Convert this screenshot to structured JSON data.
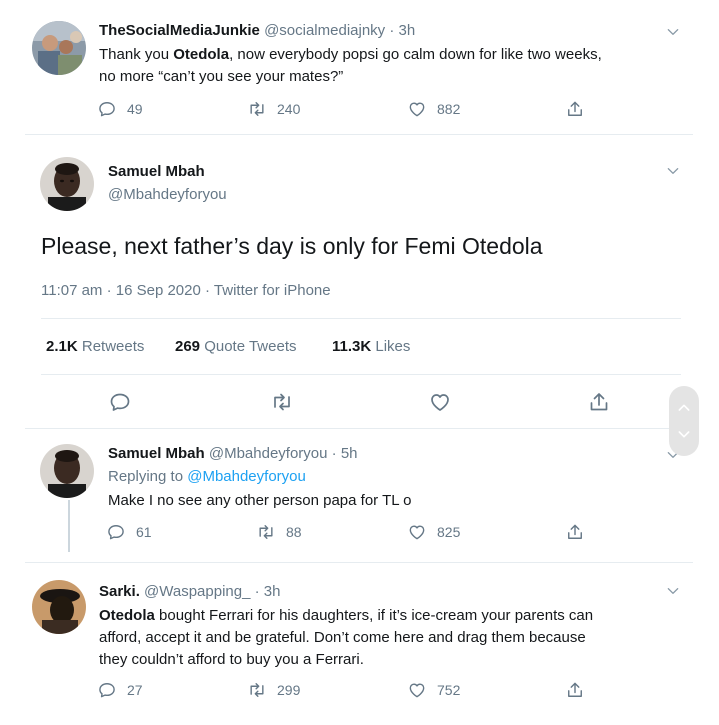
{
  "tweet1": {
    "display_name": "TheSocialMediaJunkie",
    "handle": "@socialmediajnky",
    "time": "· 3h",
    "text_prefix": "Thank you ",
    "text_bold": "Otedola",
    "text_rest": ", now everybody popsi go calm down for like two weeks,",
    "text_line2": "no more “can’t you see your mates?”",
    "replies": "49",
    "retweets": "240",
    "likes": "882"
  },
  "main_tweet": {
    "display_name": "Samuel Mbah",
    "handle": "@Mbahdeyforyou",
    "text": "Please, next father’s day is only for Femi Otedola",
    "meta": "11:07 am · 16 Sep 2020 · Twitter for iPhone",
    "retweets_count": "2.1K",
    "retweets_label": "Retweets",
    "quote_count": "269",
    "quote_label": "Quote Tweets",
    "likes_count": "11.3K",
    "likes_label": "Likes"
  },
  "reply1": {
    "display_name": "Samuel Mbah",
    "handle": "@Mbahdeyforyou",
    "time": "· 5h",
    "replying_label": "Replying to",
    "replying_handle": "@Mbahdeyforyou",
    "text": "Make I no see any other person papa for TL o",
    "replies": "61",
    "retweets": "88",
    "likes": "825"
  },
  "reply2": {
    "display_name": "Sarki.",
    "handle": "@Waspapping_",
    "time": "· 3h",
    "text_bold": "Otedola",
    "text_line1_rest": " bought Ferrari for his daughters, if it’s ice-cream your parents can",
    "text_line2": "afford, accept it and be grateful. Don’t come here and drag them because",
    "text_line3": "they couldn’t afford to buy you a Ferrari.",
    "replies": "27",
    "retweets": "299",
    "likes": "752"
  },
  "icons": {
    "reply": "reply-icon",
    "retweet": "retweet-icon",
    "like": "heart-icon",
    "share": "share-icon",
    "more": "chevron-down-icon"
  },
  "colors": {
    "accent": "#1da1f2",
    "muted": "#657786",
    "text": "#14171a",
    "divider": "#e6ecf0"
  }
}
